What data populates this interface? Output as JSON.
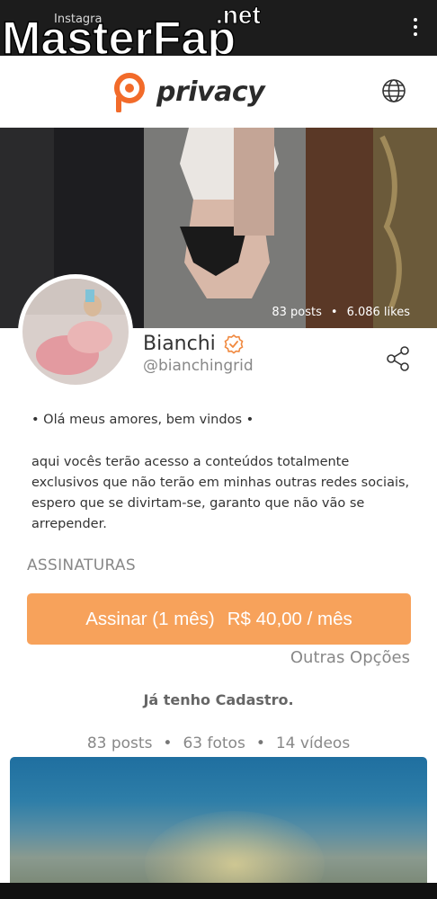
{
  "browser": {
    "tab_title": "Instagra"
  },
  "watermark": {
    "brand": "MasterFap",
    "suffix": ".net"
  },
  "header": {
    "logo_text": "privacy"
  },
  "cover": {
    "posts": "83 posts",
    "likes": "6.086 likes",
    "separator": "•"
  },
  "profile": {
    "name": "Bianchi",
    "handle": "@bianchingrid",
    "bio_line1": "• Olá meus amores, bem vindos •",
    "bio_line2": "aqui vocês terão acesso a conteúdos totalmente exclusivos que não terão em minhas outras redes sociais, espero que se divirtam-se, garanto que não vão se arrepender."
  },
  "subscriptions": {
    "label": "ASSINATURAS",
    "button_plan": "Assinar (1 mês)",
    "button_price": "R$ 40,00 / mês",
    "other_options": "Outras Opções",
    "login": "Já tenho Cadastro."
  },
  "counts": {
    "posts": "83 posts",
    "photos": "63 fotos",
    "videos": "14 vídeos",
    "separator": "•"
  },
  "colors": {
    "accent": "#f7a25b",
    "logo_orange": "#f26b2a",
    "verified": "#f0883e"
  },
  "icons": [
    "kebab-menu-icon",
    "privacy-logo-icon",
    "globe-icon",
    "verified-badge-icon",
    "share-icon"
  ]
}
